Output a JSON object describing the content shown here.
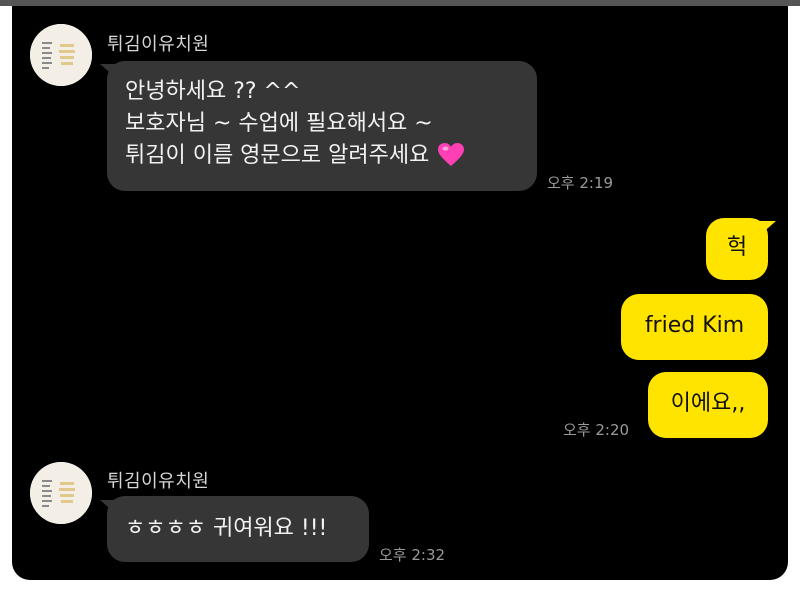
{
  "thread": {
    "messages": [
      {
        "sender": "튀김이유치원",
        "lines": [
          "안녕하세요 ?? ^^",
          "보호자님 ~ 수업에 필요해서요 ~",
          "튀김이 이름 영문으로 알려주세요"
        ],
        "emoji": "heart-icon",
        "time": "오후 2:19"
      },
      {
        "text": "헉"
      },
      {
        "text": "fried Kim"
      },
      {
        "text": "이에요,,",
        "time": "오후 2:20"
      },
      {
        "sender": "튀김이유치원",
        "lines": [
          "ㅎㅎㅎㅎ 귀여워요 !!!"
        ],
        "time": "오후 2:32"
      }
    ]
  },
  "colors": {
    "background": "#000000",
    "incoming_bubble": "#363636",
    "outgoing_bubble": "#ffe400",
    "heart": "#ff3fb4"
  }
}
